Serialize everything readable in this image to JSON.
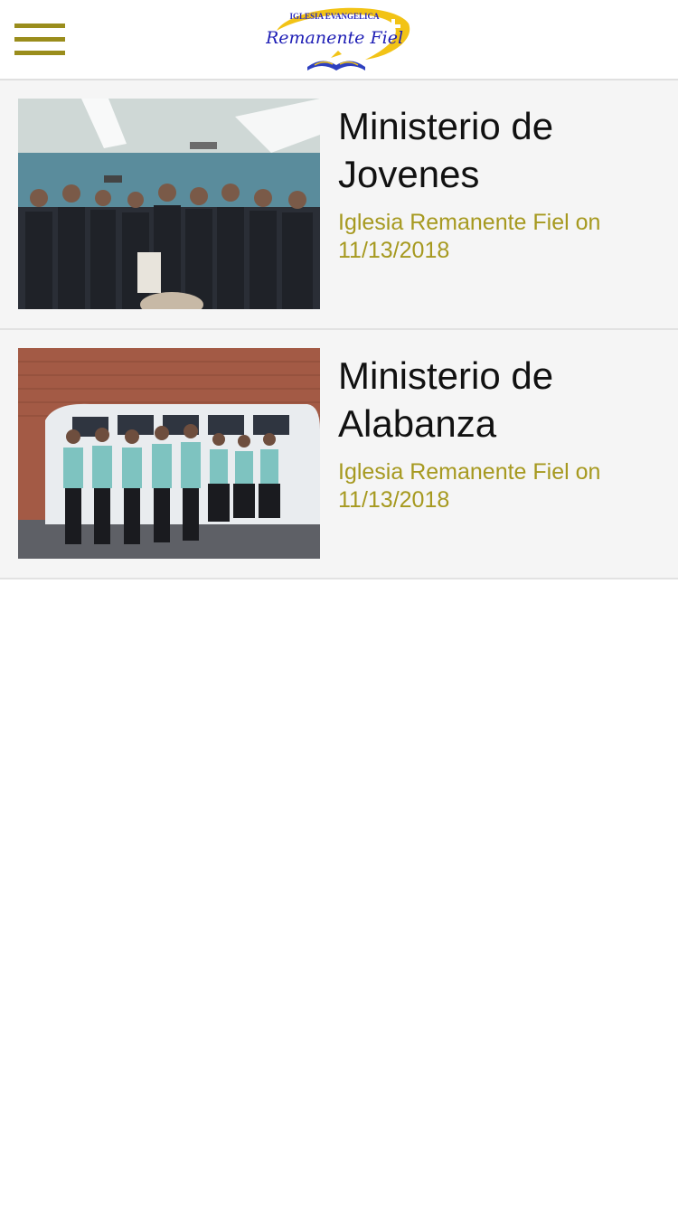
{
  "header": {
    "menu_icon": "hamburger-menu-icon",
    "accent_color": "#9a8d1c",
    "logo": {
      "top_text": "IGLESIA EVANGELICA",
      "name": "Remanente Fiel"
    }
  },
  "posts": [
    {
      "title": "Ministerio de Jovenes",
      "author": "Iglesia Remanente Fiel",
      "on_word": "on",
      "date": "11/13/2018"
    },
    {
      "title": "Ministerio de Alabanza",
      "author": "Iglesia Remanente Fiel",
      "on_word": "on",
      "date": "11/13/2018"
    }
  ],
  "colors": {
    "meta_text": "#a6991f",
    "card_bg": "#f5f5f5"
  }
}
